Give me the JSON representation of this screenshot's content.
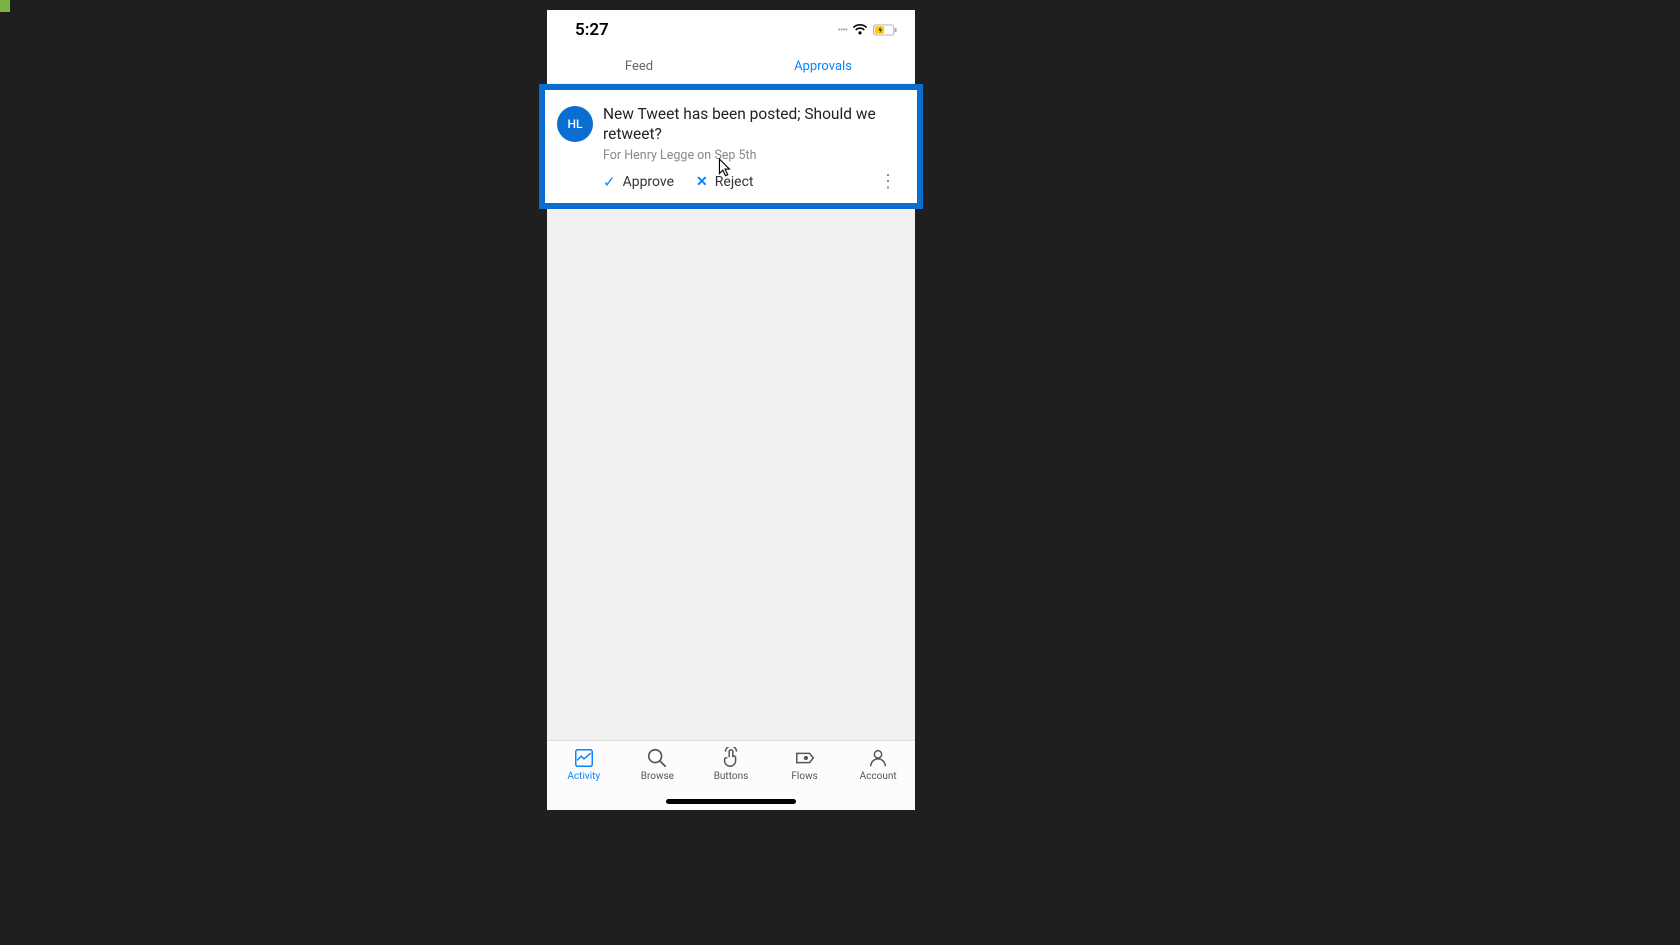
{
  "statusBar": {
    "time": "5:27"
  },
  "tabs": {
    "feed": "Feed",
    "approvals": "Approvals"
  },
  "approvalCard": {
    "avatarInitials": "HL",
    "title": "New Tweet has been posted; Should we retweet?",
    "meta": "For Henry Legge on Sep 5th",
    "approveLabel": "Approve",
    "rejectLabel": "Reject"
  },
  "bottomNav": {
    "activity": "Activity",
    "browse": "Browse",
    "buttons": "Buttons",
    "flows": "Flows",
    "account": "Account"
  }
}
